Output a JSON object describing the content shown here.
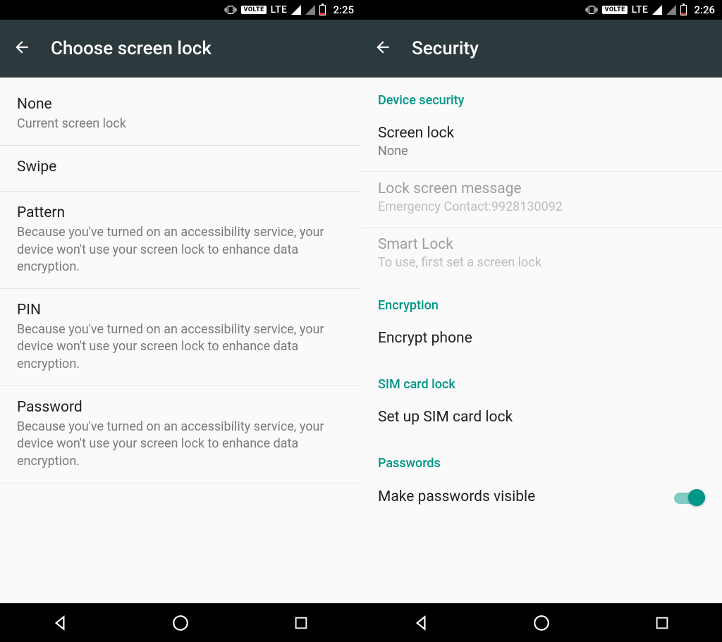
{
  "left": {
    "status": {
      "volte": "VOLTE",
      "net": "LTE",
      "time": "2:25"
    },
    "appbar": {
      "title": "Choose screen lock"
    },
    "items": [
      {
        "title": "None",
        "sub": "Current screen lock"
      },
      {
        "title": "Swipe",
        "sub": ""
      },
      {
        "title": "Pattern",
        "sub": "Because you've turned on an accessibility service, your device won't use your screen lock to enhance data encryption."
      },
      {
        "title": "PIN",
        "sub": "Because you've turned on an accessibility service, your device won't use your screen lock to enhance data encryption."
      },
      {
        "title": "Password",
        "sub": "Because you've turned on an accessibility service, your device won't use your screen lock to enhance data encryption."
      }
    ]
  },
  "right": {
    "status": {
      "volte": "VOLTE",
      "net": "LTE",
      "time": "2:26"
    },
    "appbar": {
      "title": "Security"
    },
    "sections": {
      "device_security": {
        "header": "Device security",
        "screen_lock": {
          "title": "Screen lock",
          "sub": "None"
        },
        "lock_msg": {
          "title": "Lock screen message",
          "sub": "Emergency Contact:9928130092"
        },
        "smart_lock": {
          "title": "Smart Lock",
          "sub": "To use, first set a screen lock"
        }
      },
      "encryption": {
        "header": "Encryption",
        "encrypt": {
          "title": "Encrypt phone"
        }
      },
      "sim": {
        "header": "SIM card lock",
        "setup": {
          "title": "Set up SIM card lock"
        }
      },
      "passwords": {
        "header": "Passwords",
        "visible": {
          "title": "Make passwords visible"
        }
      }
    }
  }
}
